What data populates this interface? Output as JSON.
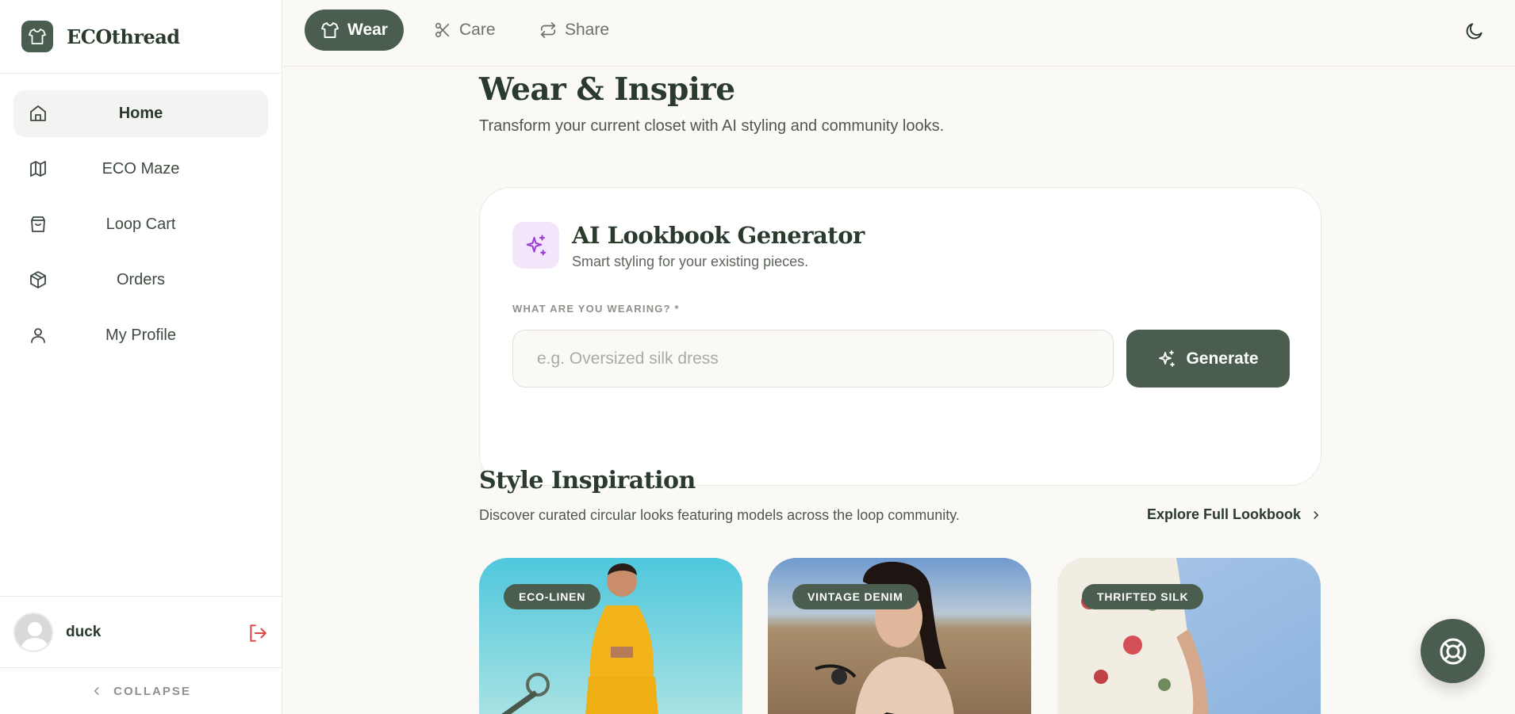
{
  "brand": {
    "name": "ECOthread"
  },
  "sidebar": {
    "items": [
      {
        "label": "Home",
        "icon": "home-icon",
        "active": true
      },
      {
        "label": "ECO Maze",
        "icon": "map-icon",
        "active": false
      },
      {
        "label": "Loop Cart",
        "icon": "shopping-bag-icon",
        "active": false
      },
      {
        "label": "Orders",
        "icon": "package-icon",
        "active": false
      },
      {
        "label": "My Profile",
        "icon": "user-icon",
        "active": false
      }
    ],
    "user": {
      "name": "duck"
    },
    "collapse_label": "COLLAPSE"
  },
  "topbar": {
    "tabs": [
      {
        "label": "Wear",
        "icon": "shirt-icon",
        "active": true
      },
      {
        "label": "Care",
        "icon": "scissors-icon",
        "active": false
      },
      {
        "label": "Share",
        "icon": "repeat-icon",
        "active": false
      }
    ],
    "theme_icon": "moon-icon"
  },
  "main": {
    "title": "Wear & Inspire",
    "subtitle": "Transform your current closet with AI styling and community looks.",
    "generator": {
      "title": "AI Lookbook Generator",
      "subtitle": "Smart styling for your existing pieces.",
      "field_label": "WHAT ARE YOU WEARING? *",
      "placeholder": "e.g. Oversized silk dress",
      "value": "",
      "button_label": "Generate"
    },
    "inspiration": {
      "title": "Style Inspiration",
      "subtitle": "Discover curated circular looks featuring models across the loop community.",
      "explore_label": "Explore Full Lookbook",
      "looks": [
        {
          "tag": "ECO-LINEN"
        },
        {
          "tag": "VINTAGE DENIM"
        },
        {
          "tag": "THRIFTED SILK"
        }
      ]
    }
  },
  "colors": {
    "accent": "#4a5d4e",
    "background": "#faf9f6",
    "sparkle": "#9b3fd6",
    "logout": "#e04848"
  }
}
